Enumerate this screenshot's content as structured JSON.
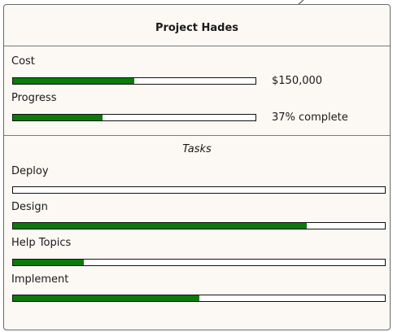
{
  "colors": {
    "card_background": "#fcf8f4",
    "border": "#6b6b6b",
    "bar_fill": "#0b7a0b",
    "bar_track": "#ffffff"
  },
  "project": {
    "title": "Project Hades"
  },
  "metrics": {
    "cost": {
      "label": "Cost",
      "value": "$150,000",
      "fill_fraction": 0.5
    },
    "progress": {
      "label": "Progress",
      "value": "37% complete",
      "fill_fraction": 0.37
    }
  },
  "tasks": {
    "heading": "Tasks",
    "items": [
      {
        "label": "Deploy",
        "fill_fraction": 0.0
      },
      {
        "label": "Design",
        "fill_fraction": 0.79
      },
      {
        "label": "Help Topics",
        "fill_fraction": 0.19
      },
      {
        "label": "Implement",
        "fill_fraction": 0.5
      }
    ]
  }
}
